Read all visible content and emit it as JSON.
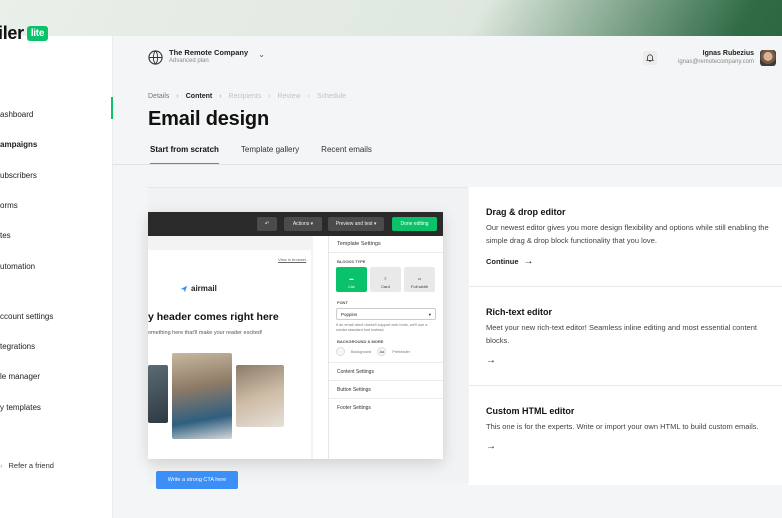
{
  "brand": {
    "name_fragment": "iler",
    "badge": "lite",
    "accent": "#09c269"
  },
  "sidebar": {
    "items": [
      {
        "label": "ashboard"
      },
      {
        "label": "ampaigns",
        "active": true
      },
      {
        "label": "ubscribers"
      },
      {
        "label": "orms"
      },
      {
        "label": "tes"
      },
      {
        "label": "utomation"
      },
      {
        "label": "ccount settings"
      },
      {
        "label": "tegrations"
      },
      {
        "label": "le manager"
      },
      {
        "label": "y templates"
      }
    ],
    "refer": "Refer a friend"
  },
  "account": {
    "company": "The Remote Company",
    "plan": "Advanced plan"
  },
  "user": {
    "name": "Ignas Rubezius",
    "email": "ignas@remotecompany.com"
  },
  "breadcrumb": [
    "Details",
    "Content",
    "Recipients",
    "Review",
    "Schedule"
  ],
  "page_title": "Email design",
  "tabs": [
    "Start from scratch",
    "Template gallery",
    "Recent emails"
  ],
  "preview": {
    "toolbar": {
      "actions": "Actions ▾",
      "preview": "Preview and test ▾",
      "done": "Done editing"
    },
    "view_in_browser": "View in browser",
    "logo": "airmail",
    "headline": "y header comes right here",
    "subline": "omething here that'll make your reader excited!",
    "cta": "Write a strong CTA here",
    "panel": {
      "title": "Template Settings",
      "blocks_type": "BLOCKS TYPE",
      "blocks": [
        "List",
        "Card",
        "Full width"
      ],
      "font_label": "FONT",
      "font_value": "Poppins",
      "font_hint": "If an email client doesn't support web fonts, we'll use a similar standard font instead.",
      "bg_label": "BACKGROUND & MORE",
      "bg_items": [
        "Background",
        "Preheader"
      ],
      "bg_badge": "Aa",
      "sections": [
        "Content Settings",
        "Button Settings",
        "Footer Settings"
      ]
    }
  },
  "editors": [
    {
      "title": "Drag & drop editor",
      "desc": "Our newest editor gives you more design flexibility and options while still enabling the simple drag & drop block functionality that you love.",
      "cta": "Continue"
    },
    {
      "title": "Rich-text editor",
      "desc": "Meet your new rich-text editor! Seamless inline editing and most essential content blocks.",
      "cta": ""
    },
    {
      "title": "Custom HTML editor",
      "desc": "This one is for the experts. Write or import your own HTML to build custom emails.",
      "cta": ""
    }
  ]
}
